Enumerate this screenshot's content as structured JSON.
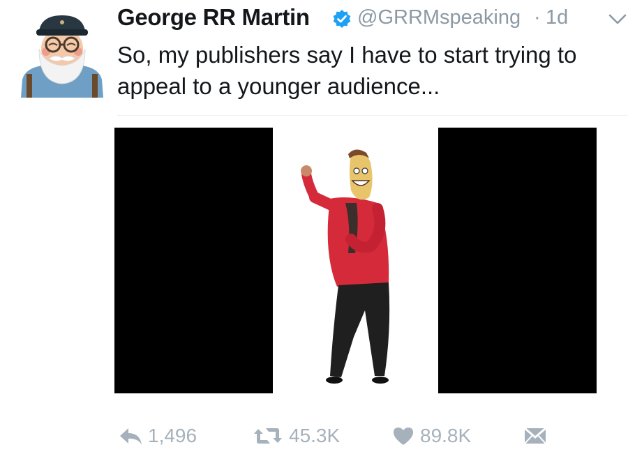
{
  "tweet": {
    "author_name": "George RR Martin",
    "handle": "@GRRMspeaking",
    "separator": "·",
    "time": "1d",
    "text": "So, my publishers say I have to start trying to appeal to a younger audience...",
    "verified": true,
    "media": {
      "description_icon": "photo",
      "background": "#000000"
    },
    "actions": {
      "reply_icon": "reply-icon",
      "reply_count": "1,496",
      "retweet_icon": "retweet-icon",
      "retweet_count": "45.3K",
      "like_icon": "heart-icon",
      "like_count": "89.8K",
      "dm_icon": "envelope-icon"
    }
  },
  "colors": {
    "text": "#14171a",
    "muted": "#8c99a5",
    "action": "#a6b1bb",
    "verified": "#1da1f2",
    "jacket": "#d42a3a"
  }
}
